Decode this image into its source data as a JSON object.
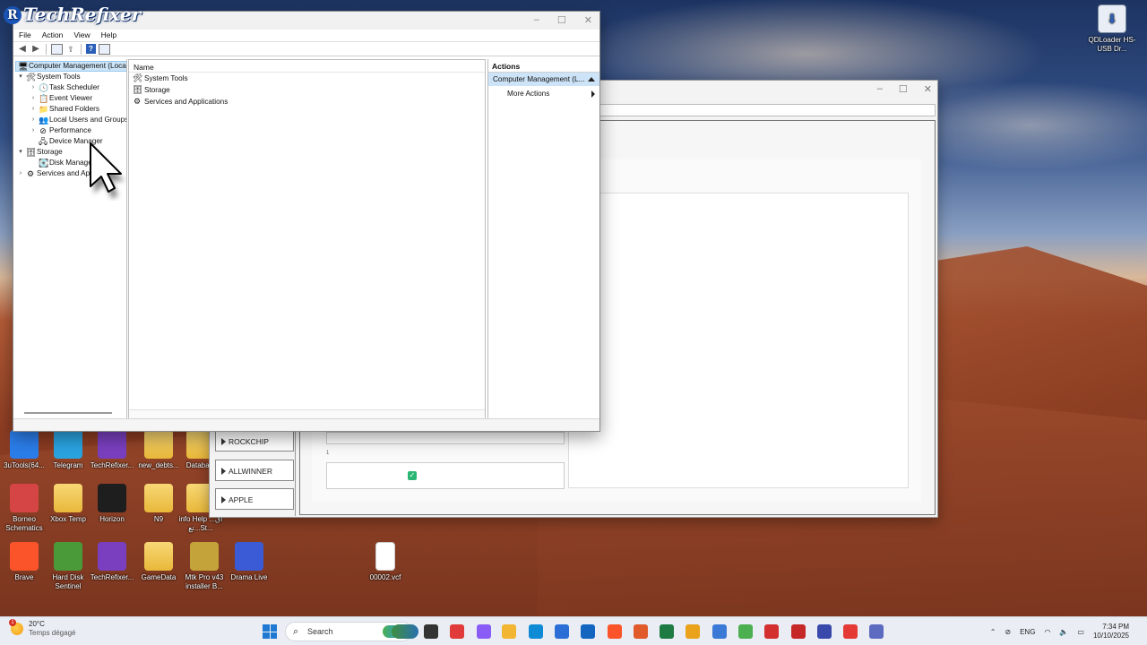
{
  "watermark": {
    "letter": "R",
    "text": "TechRefixer"
  },
  "desktop": {
    "top_right_icon": "QDLoader HS-USB Dr...",
    "icons": [
      {
        "label": "3uTools(64...",
        "kind": "app",
        "color": "#2b7de9"
      },
      {
        "label": "Telegram",
        "kind": "app",
        "color": "#2aa3df"
      },
      {
        "label": "TechRefixer...",
        "kind": "app",
        "color": "#7a3fbf"
      },
      {
        "label": "new_debts...",
        "kind": "folder",
        "color": "#e8b83a"
      },
      {
        "label": "Databa...",
        "kind": "folder",
        "color": "#e8b83a"
      },
      {
        "label": "Borneo Schematics",
        "kind": "app",
        "color": "#d64545"
      },
      {
        "label": "Xbox Temp",
        "kind": "folder",
        "color": "#e8b83a"
      },
      {
        "label": "Horizon",
        "kind": "app",
        "color": "#1e1e1e"
      },
      {
        "label": "N9",
        "kind": "folder",
        "color": "#e8b83a"
      },
      {
        "label": "info Help ...اق تع...St...",
        "kind": "folder",
        "color": "#e8b83a"
      },
      {
        "label": "Brave",
        "kind": "app",
        "color": "#fb542b"
      },
      {
        "label": "Hard Disk Sentinel",
        "kind": "app",
        "color": "#4a9a3a"
      },
      {
        "label": "TechRefixer...",
        "kind": "app",
        "color": "#7a3fbf"
      },
      {
        "label": "GameData",
        "kind": "folder",
        "color": "#e8b83a"
      },
      {
        "label": "Mtk Pro v43 installer B...",
        "kind": "app",
        "color": "#c4a43a"
      },
      {
        "label": "Drama Live",
        "kind": "app",
        "color": "#3b5bd6"
      },
      {
        "label": "00002.vcf",
        "kind": "doc",
        "color": "#ffffff"
      }
    ]
  },
  "backwin": {
    "buttons": [
      "ROCKCHIP",
      "ALLWINNER",
      "APPLE"
    ],
    "small_mark": "1"
  },
  "mmc": {
    "title_suffix": "nt",
    "menu": [
      "File",
      "Action",
      "View",
      "Help"
    ],
    "tree": [
      {
        "label": "Computer Management (Local",
        "level": 0,
        "exp": "",
        "icon": "computer-icon",
        "glyph": "🖥"
      },
      {
        "label": "System Tools",
        "level": 1,
        "exp": "▾",
        "icon": "tools-icon",
        "glyph": "🛠"
      },
      {
        "label": "Task Scheduler",
        "level": 2,
        "exp": "›",
        "icon": "clock-icon",
        "glyph": "🕓"
      },
      {
        "label": "Event Viewer",
        "level": 2,
        "exp": "›",
        "icon": "event-log-icon",
        "glyph": "📋"
      },
      {
        "label": "Shared Folders",
        "level": 2,
        "exp": "›",
        "icon": "shared-folder-icon",
        "glyph": "📁"
      },
      {
        "label": "Local Users and Groups",
        "level": 2,
        "exp": "›",
        "icon": "users-icon",
        "glyph": "👥"
      },
      {
        "label": "Performance",
        "level": 2,
        "exp": "›",
        "icon": "performance-icon",
        "glyph": "⊘"
      },
      {
        "label": "Device Manager",
        "level": 2,
        "exp": "",
        "icon": "device-manager-icon",
        "glyph": "🖧"
      },
      {
        "label": "Storage",
        "level": 1,
        "exp": "▾",
        "icon": "storage-icon",
        "glyph": "🗄"
      },
      {
        "label": "Disk Manage",
        "level": 2,
        "exp": "",
        "icon": "disk-icon",
        "glyph": "💽"
      },
      {
        "label": "Services and App",
        "level": 1,
        "exp": "›",
        "icon": "services-icon",
        "glyph": "⚙"
      }
    ],
    "center": {
      "column": "Name",
      "rows": [
        {
          "label": "System Tools",
          "icon": "tools-icon",
          "glyph": "🛠"
        },
        {
          "label": "Storage",
          "icon": "storage-icon",
          "glyph": "🗄"
        },
        {
          "label": "Services and Applications",
          "icon": "services-icon",
          "glyph": "⚙"
        }
      ]
    },
    "actions": {
      "header": "Actions",
      "group": "Computer Management (L...",
      "items": [
        "More Actions"
      ]
    }
  },
  "taskbar": {
    "weather_badge": "1",
    "temp": "20°C",
    "condition": "Temps dégagé",
    "search_placeholder": "Search",
    "lang": "ENG",
    "time": "7:34 PM",
    "date": "10/10/2025",
    "apps": [
      {
        "name": "file-explorer-icon",
        "color": "#f4c342"
      },
      {
        "name": "terminal-icon",
        "color": "#333333"
      },
      {
        "name": "media-player-icon",
        "color": "#e03a3a"
      },
      {
        "name": "copilot-icon",
        "color": "#8a5cf6"
      },
      {
        "name": "folder-icon",
        "color": "#f2b632"
      },
      {
        "name": "edge-icon",
        "color": "#0f8bd6"
      },
      {
        "name": "store-icon",
        "color": "#2b6fd6"
      },
      {
        "name": "outlook-icon",
        "color": "#1465c0"
      },
      {
        "name": "brave-icon",
        "color": "#fb542b"
      },
      {
        "name": "tool-icon",
        "color": "#e05a2a"
      },
      {
        "name": "excel-icon",
        "color": "#1d7a43"
      },
      {
        "name": "chrome-icon",
        "color": "#e9a21a"
      },
      {
        "name": "maps-icon",
        "color": "#3a79d6"
      },
      {
        "name": "utorrent-icon",
        "color": "#4caf50"
      },
      {
        "name": "acrobat-icon",
        "color": "#d32f2f"
      },
      {
        "name": "unlock-tool-icon",
        "color": "#c62828"
      },
      {
        "name": "gear-tool-icon",
        "color": "#3949ab"
      },
      {
        "name": "app-c-icon",
        "color": "#e53935"
      },
      {
        "name": "network-tool-icon",
        "color": "#5c6bc0"
      }
    ]
  }
}
